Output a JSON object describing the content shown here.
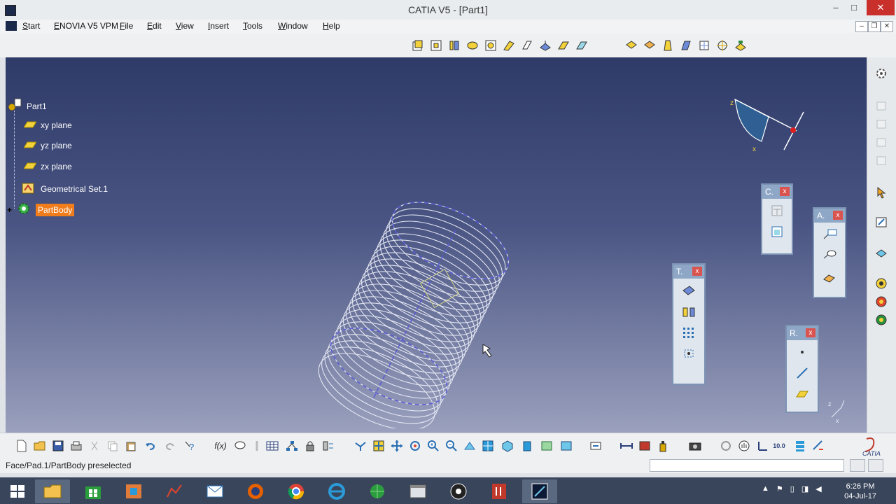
{
  "window": {
    "title": "CATIA V5 - [Part1]",
    "minimize": "–",
    "maximize": "□",
    "close": "✕",
    "mdi_minimize": "–",
    "mdi_restore": "❐",
    "mdi_close": "✕"
  },
  "menu": [
    "Start",
    "ENOVIA V5 VPM",
    "File",
    "Edit",
    "View",
    "Insert",
    "Tools",
    "Window",
    "Help"
  ],
  "tree": {
    "root": "Part1",
    "items": [
      "xy plane",
      "yz plane",
      "zx plane",
      "Geometrical Set.1",
      "PartBody"
    ]
  },
  "compass_labels": {
    "z": "z",
    "x": "x"
  },
  "mini_axis": {
    "z": "z",
    "x": "x"
  },
  "palettes": {
    "c": {
      "label": "C.",
      "close": "x"
    },
    "a": {
      "label": "A.",
      "close": "x"
    },
    "t": {
      "label": "T.",
      "close": "x"
    },
    "r": {
      "label": "R.",
      "close": "x"
    }
  },
  "bottom": {
    "fx": "f(x)",
    "tenzero": "10.0"
  },
  "status": {
    "text": "Face/Pad.1/PartBody preselected"
  },
  "taskbar": {
    "time": "6:26 PM",
    "date": "04-Jul-17"
  },
  "brand": {
    "catia": "CATIA"
  }
}
